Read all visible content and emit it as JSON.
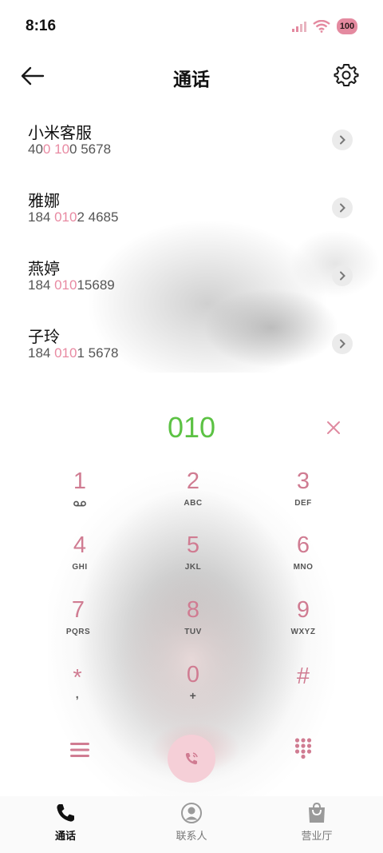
{
  "status_bar": {
    "time": "8:16",
    "battery": "100"
  },
  "header": {
    "title": "通话"
  },
  "contacts": [
    {
      "name": "小米客服",
      "number_parts": [
        {
          "t": "40",
          "hl": false
        },
        {
          "t": "0",
          "hl": true
        },
        {
          "t": " ",
          "hl": false
        },
        {
          "t": "10",
          "hl": true
        },
        {
          "t": "0 5678",
          "hl": false
        }
      ]
    },
    {
      "name": "雅娜",
      "number_parts": [
        {
          "t": "184 ",
          "hl": false
        },
        {
          "t": "010",
          "hl": true
        },
        {
          "t": "2 4685",
          "hl": false
        }
      ]
    },
    {
      "name": "燕婷",
      "number_parts": [
        {
          "t": "184 ",
          "hl": false
        },
        {
          "t": "010",
          "hl": true
        },
        {
          "t": "15689",
          "hl": false
        }
      ]
    },
    {
      "name": "子玲",
      "number_parts": [
        {
          "t": "184 ",
          "hl": false
        },
        {
          "t": "010",
          "hl": true
        },
        {
          "t": "1 5678",
          "hl": false
        }
      ]
    }
  ],
  "dialer": {
    "display": "010",
    "keys": [
      {
        "digit": "1",
        "letters": "voicemail-icon"
      },
      {
        "digit": "2",
        "letters": "ABC"
      },
      {
        "digit": "3",
        "letters": "DEF"
      },
      {
        "digit": "4",
        "letters": "GHI"
      },
      {
        "digit": "5",
        "letters": "JKL"
      },
      {
        "digit": "6",
        "letters": "MNO"
      },
      {
        "digit": "7",
        "letters": "PQRS"
      },
      {
        "digit": "8",
        "letters": "TUV"
      },
      {
        "digit": "9",
        "letters": "WXYZ"
      },
      {
        "digit": "*",
        "letters": ","
      },
      {
        "digit": "0",
        "letters": "+"
      },
      {
        "digit": "#",
        "letters": ""
      }
    ],
    "colors": {
      "digit": "#d07c92",
      "display": "#5cc244",
      "call_bg": "#f5cfd7"
    }
  },
  "nav": {
    "items": [
      {
        "label": "通话",
        "icon": "phone-icon",
        "active": true
      },
      {
        "label": "联系人",
        "icon": "contacts-icon",
        "active": false
      },
      {
        "label": "营业厅",
        "icon": "shopping-bag-icon",
        "active": false
      }
    ]
  }
}
